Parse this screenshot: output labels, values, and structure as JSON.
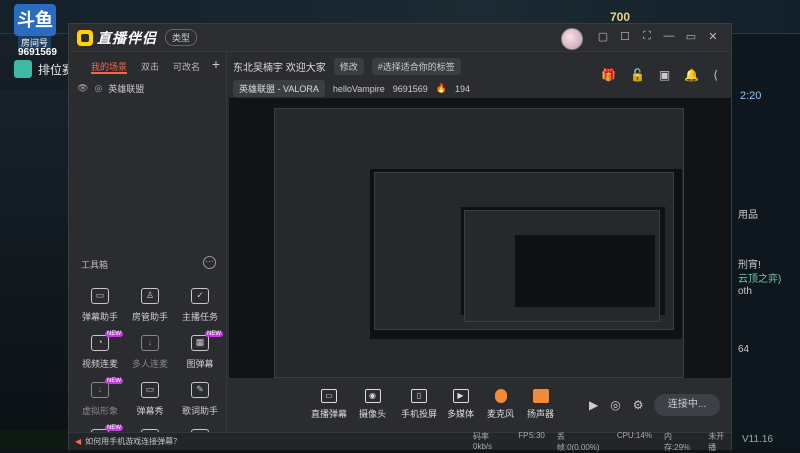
{
  "background": {
    "logo_text": "斗鱼",
    "room_label": "房间号",
    "room_id": "9691569",
    "rank_label": "排位赛",
    "gold": "700",
    "time": "2:20",
    "right_texts": [
      "用品",
      "刑宵!",
      "云顶之弈)",
      "oth",
      "64"
    ],
    "version": "V11.16"
  },
  "app": {
    "title": "直播伴侣",
    "type_pill": "类型",
    "window_icons": [
      "▢",
      "☐",
      "⛶",
      "—",
      "▭",
      "✕"
    ]
  },
  "sidebar": {
    "tabs": [
      "我的场景",
      "双击",
      "可改名"
    ],
    "add": "+",
    "scene_item": "英雄联盟",
    "toolbox_title": "工具箱",
    "toolbox_more": "···",
    "tools": [
      {
        "label": "弹幕助手",
        "icon": "▭",
        "new": ""
      },
      {
        "label": "房管助手",
        "icon": "♙",
        "new": ""
      },
      {
        "label": "主播任务",
        "icon": "✓",
        "new": ""
      },
      {
        "label": "视频连麦",
        "icon": "◔",
        "new": "NEW"
      },
      {
        "label": "多人连麦",
        "icon": "↓",
        "new": ""
      },
      {
        "label": "图弹幕",
        "icon": "▦",
        "new": "NEW"
      },
      {
        "label": "虚拟形象",
        "icon": "↓",
        "new": "NEW"
      },
      {
        "label": "弹幕秀",
        "icon": "▭",
        "new": ""
      },
      {
        "label": "歌词助手",
        "icon": "✎",
        "new": ""
      },
      {
        "label": "",
        "icon": "♡",
        "new": "NEW"
      },
      {
        "label": "",
        "icon": "↓",
        "new": ""
      },
      {
        "label": "",
        "icon": "◬",
        "new": ""
      }
    ]
  },
  "stream": {
    "title": "东北吴楠宇 欢迎大家",
    "edit_btn": "修改",
    "tag_btn": "#选择适合你的标签",
    "category": "英雄联盟 - VALORA",
    "user": "helloVampire",
    "room_id": "9691569",
    "hot": "194"
  },
  "bottombar": {
    "items": [
      {
        "label": "直播弹幕",
        "icon": "▭"
      },
      {
        "label": "摄像头",
        "icon": "◉"
      },
      {
        "label": "手机投屏",
        "icon": "▯"
      },
      {
        "label": "多媒体",
        "icon": "▶"
      },
      {
        "label": "麦克风",
        "icon": ""
      },
      {
        "label": "扬声器",
        "icon": ""
      }
    ],
    "live_button": "连接中..."
  },
  "statusbar": {
    "news": "如何用手机游戏连接弹幕？",
    "speed": "码率0kb/s",
    "fps": "FPS:30",
    "drop": "丢帧:0(0.00%)",
    "cpu": "CPU:14%",
    "mem": "内存:29%",
    "state": "未开播"
  }
}
